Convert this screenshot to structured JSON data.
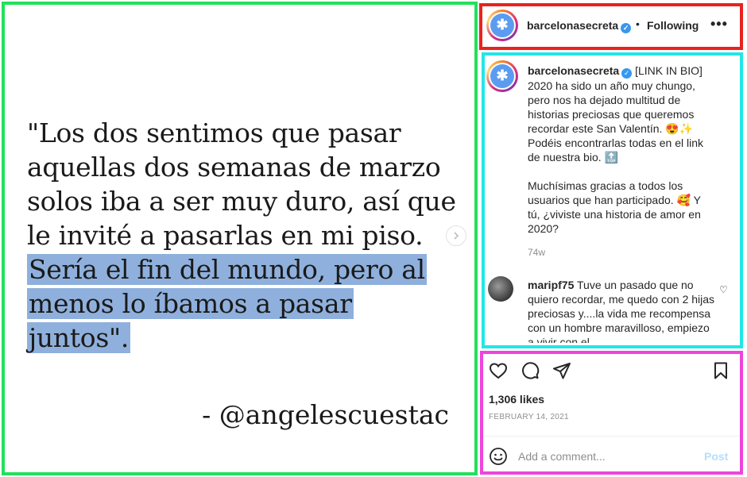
{
  "post_image": {
    "quote_plain": "\"Los dos sentimos que pasar aquellas dos semanas de marzo solos iba a ser muy duro, así que le invité a pasarlas en mi piso.",
    "quote_highlight": "Sería el fin del mundo, pero al menos lo íbamos a pasar juntos\".",
    "author": "- @angelescuestac",
    "next_icon": "chevron-right-icon"
  },
  "header": {
    "username": "barcelonasecreta",
    "separator": "•",
    "follow_status": "Following",
    "more_icon": "•••",
    "avatar_glyph": "✱"
  },
  "caption": {
    "username": "barcelonasecreta",
    "text_1": "[LINK IN BIO] 2020 ha sido un año muy chungo, pero nos ha dejado multitud de historias preciosas que queremos recordar este San Valentín. 😍✨ Podéis encontrarlas todas en el link de nuestra bio. 🔝",
    "text_2": "Muchísimas gracias a todos los usuarios que han participado. 🥰 Y tú, ¿viviste una historia de amor en 2020?",
    "time": "74w"
  },
  "comment": {
    "username": "maripf75",
    "text": "Tuve un pasado que no quiero recordar, me quedo con 2 hijas preciosas y....la vida me recompensa con un hombre maravilloso, empiezo a vivir con el",
    "like_icon": "♡"
  },
  "actions": {
    "likes": "1,306 likes",
    "date": "FEBRUARY 14, 2021",
    "comment_placeholder": "Add a comment...",
    "post_label": "Post",
    "post_color": "#b2dffc"
  },
  "colors": {
    "highlight": "#8fb0dc",
    "verified": "#3897f0",
    "frame_image": "#22e05a",
    "frame_header": "#e8231f",
    "frame_comments": "#22e6e6",
    "frame_actions": "#ee44dd"
  }
}
